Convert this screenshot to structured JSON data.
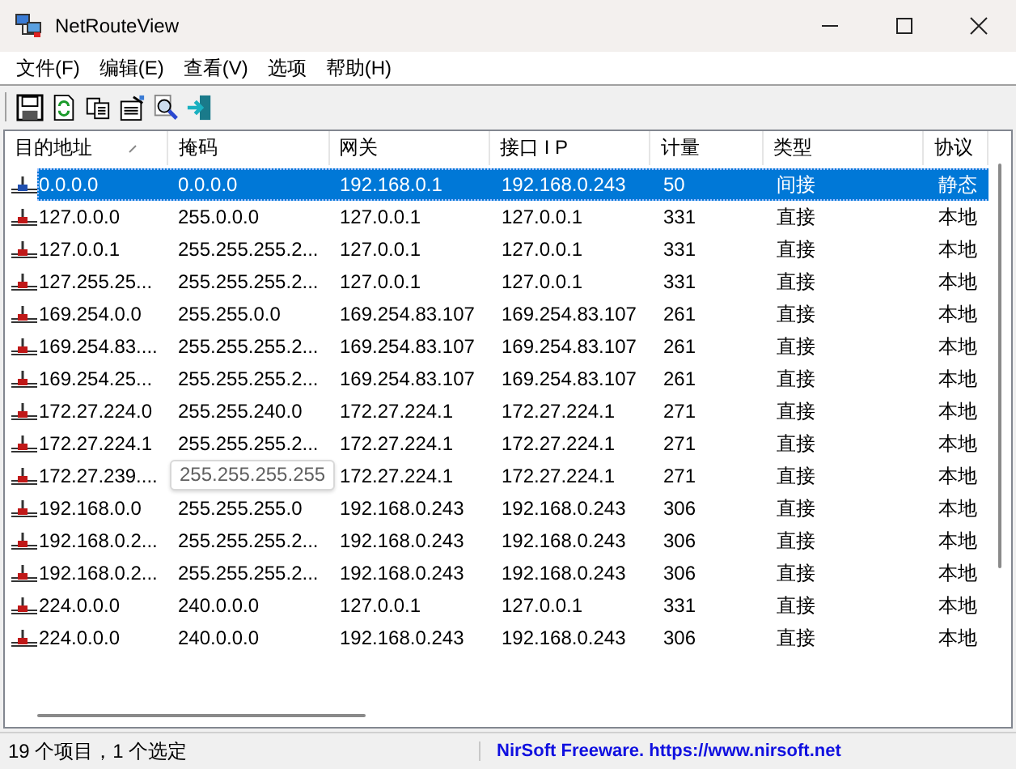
{
  "window": {
    "title": "NetRouteView"
  },
  "menu": [
    "文件(F)",
    "编辑(E)",
    "查看(V)",
    "选项",
    "帮助(H)"
  ],
  "table": {
    "columns": [
      {
        "label": "目的地址",
        "sorted": true
      },
      {
        "label": "掩码",
        "sorted": false
      },
      {
        "label": "网关",
        "sorted": false
      },
      {
        "label": "接口 I P",
        "sorted": false
      },
      {
        "label": "计量",
        "sorted": false
      },
      {
        "label": "类型",
        "sorted": false
      },
      {
        "label": "协议",
        "sorted": false
      }
    ],
    "rows": [
      {
        "selected": true,
        "cells": [
          "0.0.0.0",
          "0.0.0.0",
          "192.168.0.1",
          "192.168.0.243",
          "50",
          "间接",
          "静态"
        ]
      },
      {
        "selected": false,
        "cells": [
          "127.0.0.0",
          "255.0.0.0",
          "127.0.0.1",
          "127.0.0.1",
          "331",
          "直接",
          "本地"
        ]
      },
      {
        "selected": false,
        "cells": [
          "127.0.0.1",
          "255.255.255.2...",
          "127.0.0.1",
          "127.0.0.1",
          "331",
          "直接",
          "本地"
        ]
      },
      {
        "selected": false,
        "cells": [
          "127.255.25...",
          "255.255.255.2...",
          "127.0.0.1",
          "127.0.0.1",
          "331",
          "直接",
          "本地"
        ]
      },
      {
        "selected": false,
        "cells": [
          "169.254.0.0",
          "255.255.0.0",
          "169.254.83.107",
          "169.254.83.107",
          "261",
          "直接",
          "本地"
        ]
      },
      {
        "selected": false,
        "cells": [
          "169.254.83....",
          "255.255.255.2...",
          "169.254.83.107",
          "169.254.83.107",
          "261",
          "直接",
          "本地"
        ]
      },
      {
        "selected": false,
        "cells": [
          "169.254.25...",
          "255.255.255.2...",
          "169.254.83.107",
          "169.254.83.107",
          "261",
          "直接",
          "本地"
        ]
      },
      {
        "selected": false,
        "cells": [
          "172.27.224.0",
          "255.255.240.0",
          "172.27.224.1",
          "172.27.224.1",
          "271",
          "直接",
          "本地"
        ]
      },
      {
        "selected": false,
        "cells": [
          "172.27.224.1",
          "255.255.255.2...",
          "172.27.224.1",
          "172.27.224.1",
          "271",
          "直接",
          "本地"
        ]
      },
      {
        "selected": false,
        "tooltip": "255.255.255.255",
        "cells": [
          "172.27.239....",
          "",
          "172.27.224.1",
          "172.27.224.1",
          "271",
          "直接",
          "本地"
        ]
      },
      {
        "selected": false,
        "cells": [
          "192.168.0.0",
          "255.255.255.0",
          "192.168.0.243",
          "192.168.0.243",
          "306",
          "直接",
          "本地"
        ]
      },
      {
        "selected": false,
        "cells": [
          "192.168.0.2...",
          "255.255.255.2...",
          "192.168.0.243",
          "192.168.0.243",
          "306",
          "直接",
          "本地"
        ]
      },
      {
        "selected": false,
        "cells": [
          "192.168.0.2...",
          "255.255.255.2...",
          "192.168.0.243",
          "192.168.0.243",
          "306",
          "直接",
          "本地"
        ]
      },
      {
        "selected": false,
        "cells": [
          "224.0.0.0",
          "240.0.0.0",
          "127.0.0.1",
          "127.0.0.1",
          "331",
          "直接",
          "本地"
        ]
      },
      {
        "selected": false,
        "cells": [
          "224.0.0.0",
          "240.0.0.0",
          "192.168.0.243",
          "192.168.0.243",
          "306",
          "直接",
          "本地"
        ]
      }
    ]
  },
  "status_bar": {
    "count": "19 个项目，1 个选定",
    "credit": "NirSoft Freeware. https://www.nirsoft.net"
  }
}
